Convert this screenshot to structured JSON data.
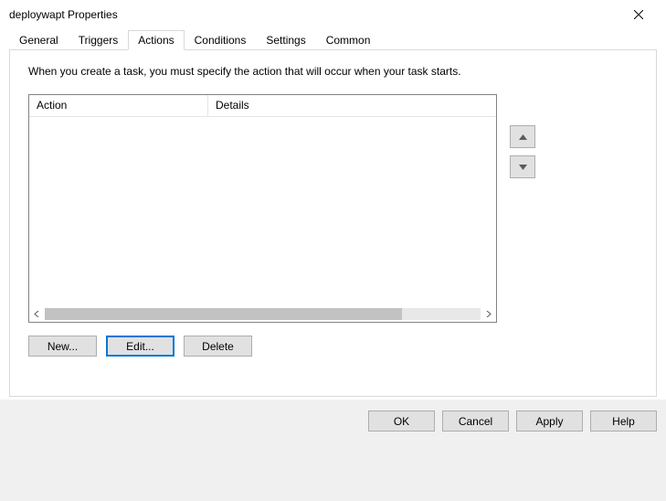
{
  "window": {
    "title": "deploywapt Properties"
  },
  "tabs": {
    "general": "General",
    "triggers": "Triggers",
    "actions": "Actions",
    "conditions": "Conditions",
    "settings": "Settings",
    "common": "Common",
    "active": "actions"
  },
  "content": {
    "description": "When you create a task, you must specify the action that will occur when your task starts."
  },
  "listview": {
    "col_action": "Action",
    "col_details": "Details",
    "rows": []
  },
  "buttons": {
    "new": "New...",
    "edit": "Edit...",
    "delete": "Delete",
    "ok": "OK",
    "cancel": "Cancel",
    "apply": "Apply",
    "help": "Help"
  }
}
